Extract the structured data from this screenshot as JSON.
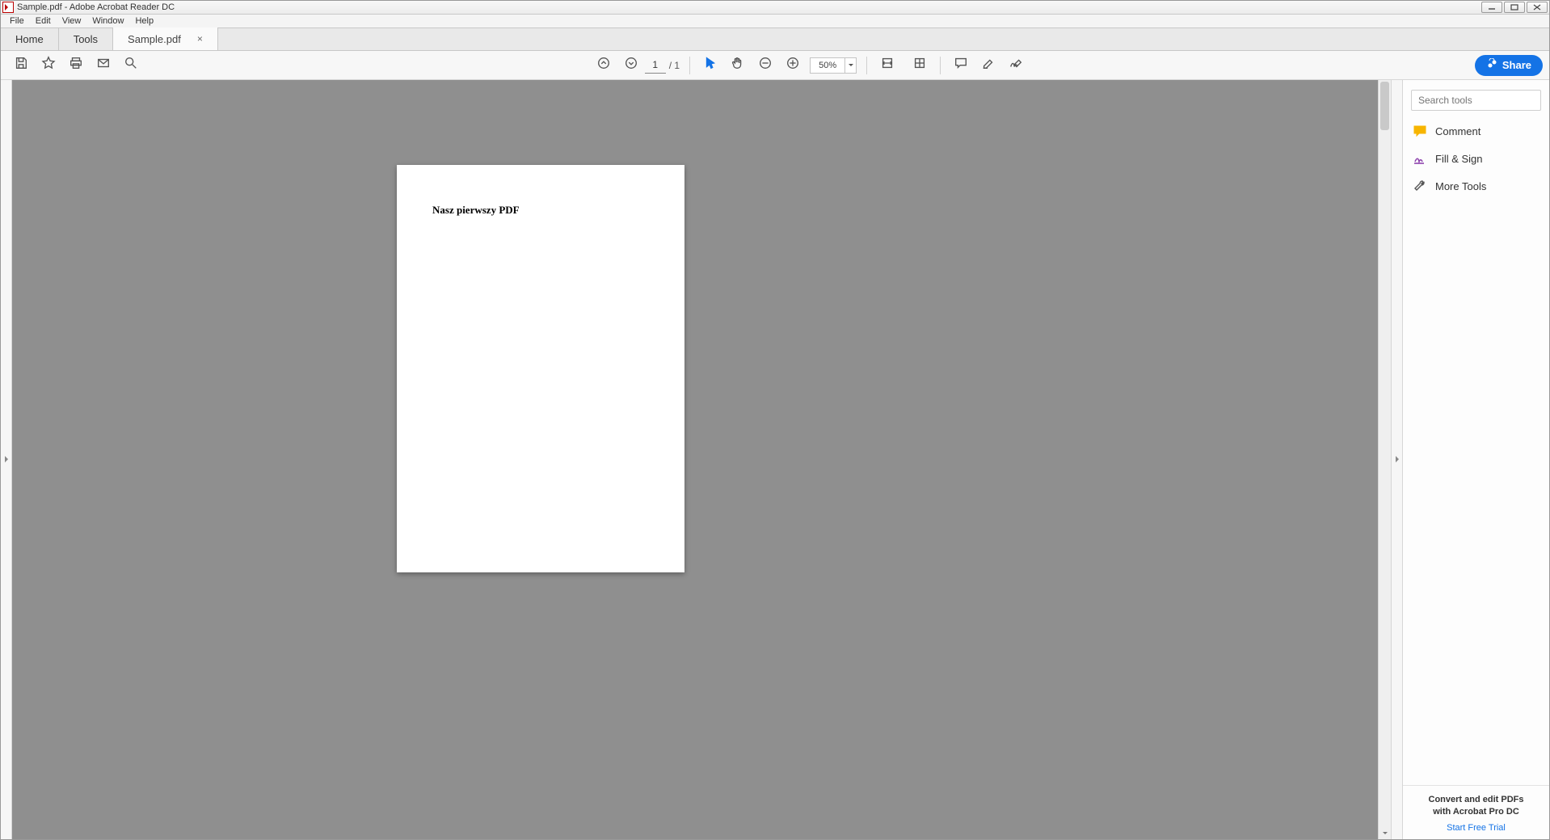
{
  "window": {
    "title": "Sample.pdf - Adobe Acrobat Reader DC"
  },
  "menubar": {
    "items": [
      "File",
      "Edit",
      "View",
      "Window",
      "Help"
    ]
  },
  "tabs": {
    "home": "Home",
    "tools": "Tools",
    "doc_label": "Sample.pdf",
    "doc_close": "×"
  },
  "toolbar": {
    "current_page": "1",
    "page_total": "/ 1",
    "zoom_value": "50%",
    "share_label": "Share"
  },
  "document": {
    "heading": "Nasz pierwszy PDF"
  },
  "right_panel": {
    "search_placeholder": "Search tools",
    "items": [
      {
        "label": "Comment"
      },
      {
        "label": "Fill & Sign"
      },
      {
        "label": "More Tools"
      }
    ],
    "promo_line1": "Convert and edit PDFs",
    "promo_line2": "with Acrobat Pro DC",
    "promo_link": "Start Free Trial"
  }
}
